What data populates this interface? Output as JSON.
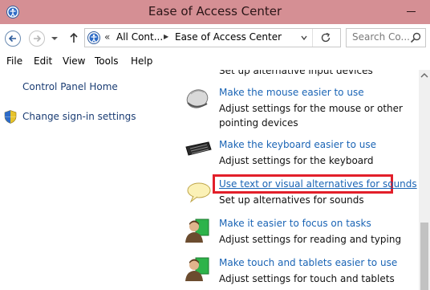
{
  "window": {
    "title": "Ease of Access Center"
  },
  "address": {
    "overflow": "«",
    "crumbs": [
      "All Cont...",
      "Ease of Access Center"
    ]
  },
  "search": {
    "placeholder": "Search Co..."
  },
  "menu": [
    "File",
    "Edit",
    "View",
    "Tools",
    "Help"
  ],
  "left_pane": {
    "home_link": "Control Panel Home",
    "signin_link": "Change sign-in settings"
  },
  "items": [
    {
      "link": "",
      "desc": "Set up alternative input devices"
    },
    {
      "link": "Make the mouse easier to use",
      "desc": "Adjust settings for the mouse or other pointing devices"
    },
    {
      "link": "Make the keyboard easier to use",
      "desc": "Adjust settings for the keyboard"
    },
    {
      "link": "Use text or visual alternatives for sounds",
      "desc": "Set up alternatives for sounds"
    },
    {
      "link": "Make it easier to focus on tasks",
      "desc": "Adjust settings for reading and typing"
    },
    {
      "link": "Make touch and tablets easier to use",
      "desc": "Adjust settings for touch and tablets"
    }
  ],
  "colors": {
    "titlebar": "#d58f94",
    "link": "#1a64b5",
    "highlight": "#e21f2a"
  }
}
